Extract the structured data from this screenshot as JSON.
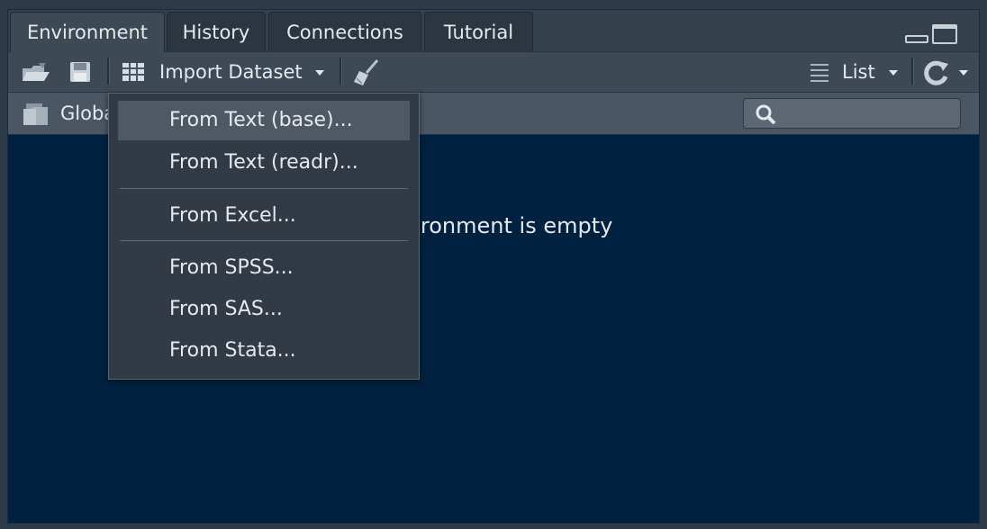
{
  "tabs": [
    "Environment",
    "History",
    "Connections",
    "Tutorial"
  ],
  "active_tab": "Environment",
  "toolbar": {
    "import_label": "Import Dataset",
    "view_label": "List",
    "icons": [
      "open-folder-icon",
      "save-icon",
      "import-dataset-icon",
      "broom-icon",
      "list-icon",
      "refresh-icon"
    ]
  },
  "env": {
    "scope_label": "Global Environment",
    "search_placeholder": ""
  },
  "empty_message": "Environment is empty",
  "menu": {
    "items": [
      "From Text (base)...",
      "From Text (readr)...",
      "From Excel...",
      "From SPSS...",
      "From SAS...",
      "From Stata..."
    ],
    "highlighted": "From Text (base)..."
  },
  "colors": {
    "pane_bg": "#00213f",
    "menu_bg": "#323b45",
    "highlight": "#4e5964"
  }
}
